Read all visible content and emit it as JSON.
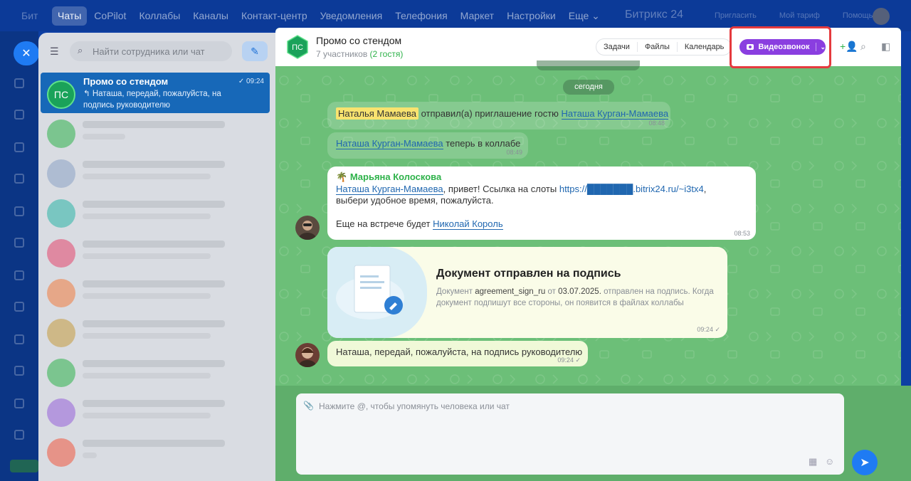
{
  "topnav": {
    "brand_left": "Бит",
    "items": [
      {
        "label": "Чаты",
        "active": true
      },
      {
        "label": "CoPilot"
      },
      {
        "label": "Коллабы"
      },
      {
        "label": "Каналы"
      },
      {
        "label": "Контакт-центр"
      },
      {
        "label": "Уведомления"
      },
      {
        "label": "Телефония"
      },
      {
        "label": "Маркет"
      },
      {
        "label": "Настройки"
      },
      {
        "label": "Еще ⌄"
      }
    ],
    "brand": "Битрикс 24",
    "links": [
      "Пригласить",
      "Мой тариф",
      "Помощь"
    ]
  },
  "chat_list": {
    "search_placeholder": "Найти сотрудника или чат",
    "active": {
      "avatar_initials": "ПС",
      "title": "Промо со стендом",
      "time": "✓ 09:24",
      "preview": "↰ Наташа, передай, пожалуйста, на подпись руководителю"
    }
  },
  "chat": {
    "avatar_initials": "ПС",
    "title": "Промо со стендом",
    "participants": "7 участников",
    "guests": "(2 гостя)",
    "tabs": [
      "Задачи",
      "Файлы",
      "Календарь"
    ],
    "video_call_label": "Видеозвонок",
    "date_label": "сегодня",
    "messages": {
      "invite": {
        "actor": "Наталья Мамаева",
        "text": "отправил(а) приглашение гостю",
        "target": "Наташа Курган-Мамаева",
        "time": "08:48"
      },
      "joined": {
        "who": "Наташа Курган-Мамаева",
        "text": "теперь в коллабе",
        "time": "08:49"
      },
      "marina": {
        "sender": "Марьяна Колоскова",
        "mention": "Наташа Курган-Мамаева",
        "text1": ", привет! Ссылка на слоты",
        "link": "https://███████.bitrix24.ru/~i3tx4",
        "text2": ", выбери удобное время, пожалуйста.",
        "text3": "Еще на встрече будет",
        "mention2": "Николай Король",
        "time": "08:53"
      },
      "doc": {
        "title": "Документ отправлен на подпись",
        "text_pre": "Документ",
        "file": "agreement_sign_ru",
        "text_mid": "от",
        "date": "03.07.2025.",
        "text_post": "отправлен на подпись. Когда документ подпишут все стороны, он появится в файлах коллабы",
        "time": "09:24 ✓"
      },
      "last": {
        "text": "Наташа, передай, пожалуйста, на подпись руководителю",
        "time": "09:24 ✓"
      }
    },
    "input_placeholder": "Нажмите @, чтобы упомянуть человека или чат"
  },
  "colors": {
    "accent_video": "#8a3ee0",
    "highlight": "#e53a3e",
    "chat_bg": "#6cbf78"
  }
}
